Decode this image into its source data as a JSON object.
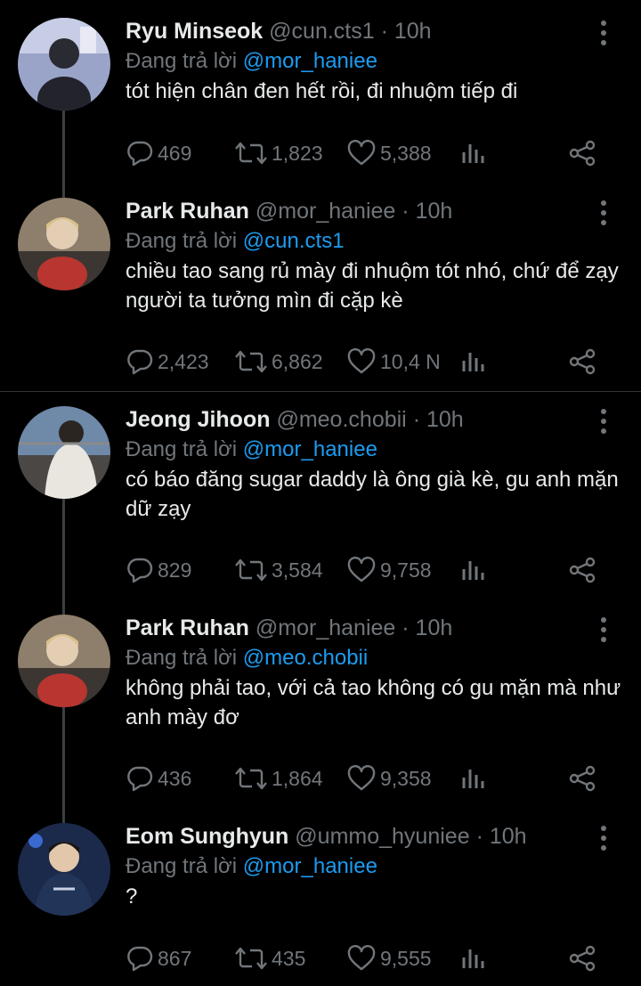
{
  "colors": {
    "background": "#000000",
    "text": "#e7e9ea",
    "muted": "#71767b",
    "link": "#1d9bf0"
  },
  "tweets": [
    {
      "name": "Ryu Minseok",
      "handle": "@cun.cts1",
      "time": "10h",
      "reply_prefix": "Đang trả lời",
      "reply_to": "@mor_haniee",
      "text": "tót hiện chân đen hết rồi, đi nhuộm tiếp đi",
      "replies": "469",
      "retweets": "1,823",
      "likes": "5,388"
    },
    {
      "name": "Park Ruhan",
      "handle": "@mor_haniee",
      "time": "10h",
      "reply_prefix": "Đang trả lời",
      "reply_to": "@cun.cts1",
      "text": "chiều tao sang rủ mày đi nhuộm tót nhó, chứ để zạy người ta tưởng mìn đi cặp kè",
      "replies": "2,423",
      "retweets": "6,862",
      "likes": "10,4 N"
    },
    {
      "name": "Jeong Jihoon",
      "handle": "@meo.chobii",
      "time": "10h",
      "reply_prefix": "Đang trả lời",
      "reply_to": "@mor_haniee",
      "text": "có báo đăng sugar daddy là ông già kè, gu anh mặn dữ zạy",
      "replies": "829",
      "retweets": "3,584",
      "likes": "9,758"
    },
    {
      "name": "Park Ruhan",
      "handle": "@mor_haniee",
      "time": "10h",
      "reply_prefix": "Đang trả lời",
      "reply_to": "@meo.chobii",
      "text": "không phải tao, với cả tao không có gu mặn mà như anh mày đơ",
      "replies": "436",
      "retweets": "1,864",
      "likes": "9,358"
    },
    {
      "name": "Eom Sunghyun",
      "handle": "@ummo_hyuniee",
      "time": "10h",
      "reply_prefix": "Đang trả lời",
      "reply_to": "@mor_haniee",
      "text": "?",
      "replies": "867",
      "retweets": "435",
      "likes": "9,555"
    }
  ]
}
